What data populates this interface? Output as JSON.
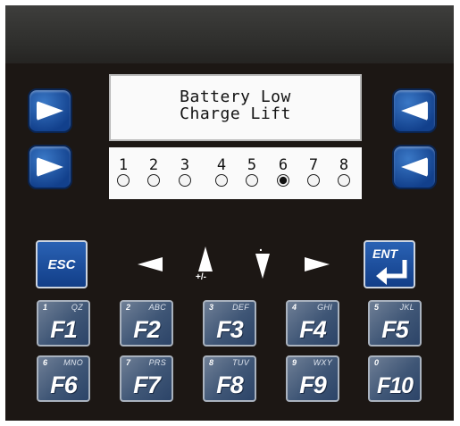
{
  "display": {
    "line1": "Battery Low",
    "line2": "Charge Lift"
  },
  "indicators": {
    "labels": [
      "1",
      "2",
      "3",
      "4",
      "5",
      "6",
      "7",
      "8"
    ],
    "active_index": 6
  },
  "keys": {
    "esc": "ESC",
    "ent": "ENT",
    "plus_minus": "+/-",
    "dot": "."
  },
  "function_keys": [
    {
      "num": "1",
      "alpha": "QZ",
      "label": "F1"
    },
    {
      "num": "2",
      "alpha": "ABC",
      "label": "F2"
    },
    {
      "num": "3",
      "alpha": "DEF",
      "label": "F3"
    },
    {
      "num": "4",
      "alpha": "GHI",
      "label": "F4"
    },
    {
      "num": "5",
      "alpha": "JKL",
      "label": "F5"
    },
    {
      "num": "6",
      "alpha": "MNO",
      "label": "F6"
    },
    {
      "num": "7",
      "alpha": "PRS",
      "label": "F7"
    },
    {
      "num": "8",
      "alpha": "TUV",
      "label": "F8"
    },
    {
      "num": "9",
      "alpha": "WXY",
      "label": "F9"
    },
    {
      "num": "0",
      "alpha": "",
      "label": "F10"
    }
  ],
  "colors": {
    "panel": "#1c1714",
    "key_blue": "#1a4d9e",
    "lcd": "#fafafa"
  }
}
